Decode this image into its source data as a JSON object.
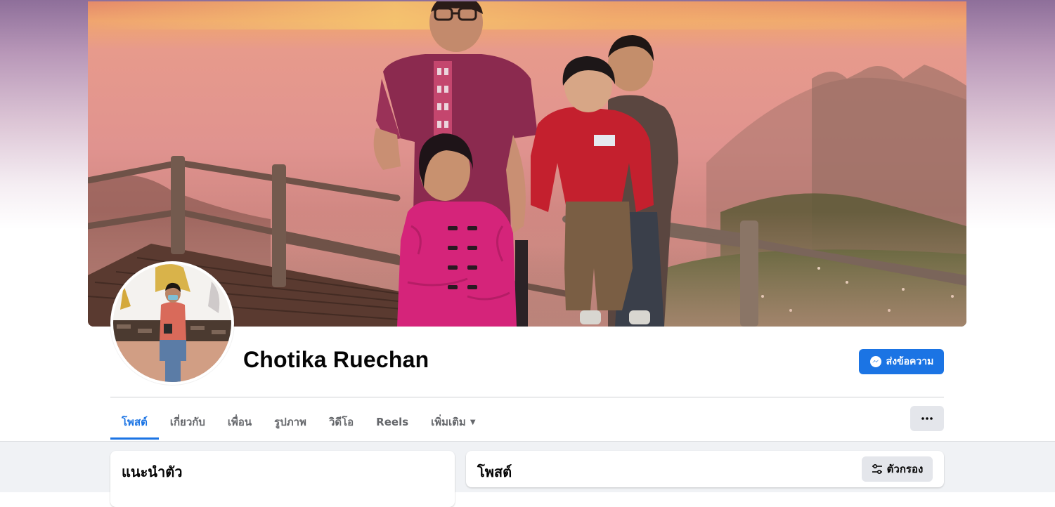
{
  "profile": {
    "name": "Chotika Ruechan",
    "message_button_label": "ส่งข้อความ"
  },
  "tabs": [
    {
      "label": "โพสต์",
      "active": true
    },
    {
      "label": "เกี่ยวกับ",
      "active": false
    },
    {
      "label": "เพื่อน",
      "active": false
    },
    {
      "label": "รูปภาพ",
      "active": false
    },
    {
      "label": "วิดีโอ",
      "active": false
    },
    {
      "label": "Reels",
      "active": false
    },
    {
      "label": "เพิ่มเติม",
      "active": false
    }
  ],
  "intro": {
    "title": "แนะนำตัว"
  },
  "posts": {
    "title": "โพสต์",
    "filter_label": "ตัวกรอง"
  },
  "icons": {
    "message": "messenger-icon",
    "more": "more-dots-icon",
    "filter": "filter-sliders-icon",
    "tab_caret": "caret-down-icon"
  },
  "colors": {
    "accent": "#1b74e4",
    "secondary_button": "#e4e6eb",
    "feed_background": "#f0f2f5",
    "text_primary": "#050505",
    "text_secondary": "#65676b"
  }
}
